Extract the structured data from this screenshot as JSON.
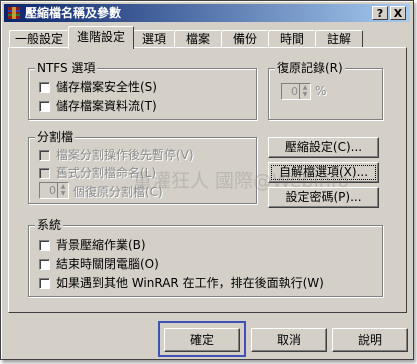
{
  "window": {
    "title": "壓縮檔名稱及參數",
    "help_btn": "?",
    "close_btn": "X"
  },
  "tabs": [
    {
      "label": "一般設定"
    },
    {
      "label": "進階設定"
    },
    {
      "label": "選項"
    },
    {
      "label": "檔案"
    },
    {
      "label": "備份"
    },
    {
      "label": "時間"
    },
    {
      "label": "註解"
    }
  ],
  "ntfs": {
    "title": "NTFS 選項",
    "items": [
      {
        "label": "儲存檔案安全性(S)",
        "checked": false
      },
      {
        "label": "儲存檔案資料流(T)",
        "checked": false
      }
    ]
  },
  "recovery": {
    "title": "復原記錄(R)",
    "value": "0",
    "unit": "%"
  },
  "split": {
    "title": "分割檔",
    "items": [
      {
        "label": "檔案分割操作後先暫停(V)",
        "checked": false
      },
      {
        "label": "舊式分割檔命名(L)",
        "checked": false
      }
    ],
    "volumes_value": "0",
    "volumes_label": "個復原分割檔(C)"
  },
  "side_buttons": {
    "compression": "壓縮設定(C)...",
    "sfx": "自解檔選項(X)...",
    "password": "設定密碼(P)..."
  },
  "system": {
    "title": "系統",
    "items": [
      {
        "label": "背景壓縮作業(B)",
        "checked": false
      },
      {
        "label": "結束時關閉電腦(O)",
        "checked": false
      },
      {
        "label": "如果遇到其他 WinRAR 在工作，排在後面執行(W)",
        "checked": false
      }
    ]
  },
  "footer": {
    "ok": "確定",
    "cancel": "取消",
    "help": "說明"
  },
  "watermark": "重灌狂人  國際@Webinfo",
  "colors": {
    "title_start": "#0a246a",
    "title_end": "#a6caf0",
    "face": "#d4d0c8",
    "highlight_box": "#3f51b5"
  }
}
